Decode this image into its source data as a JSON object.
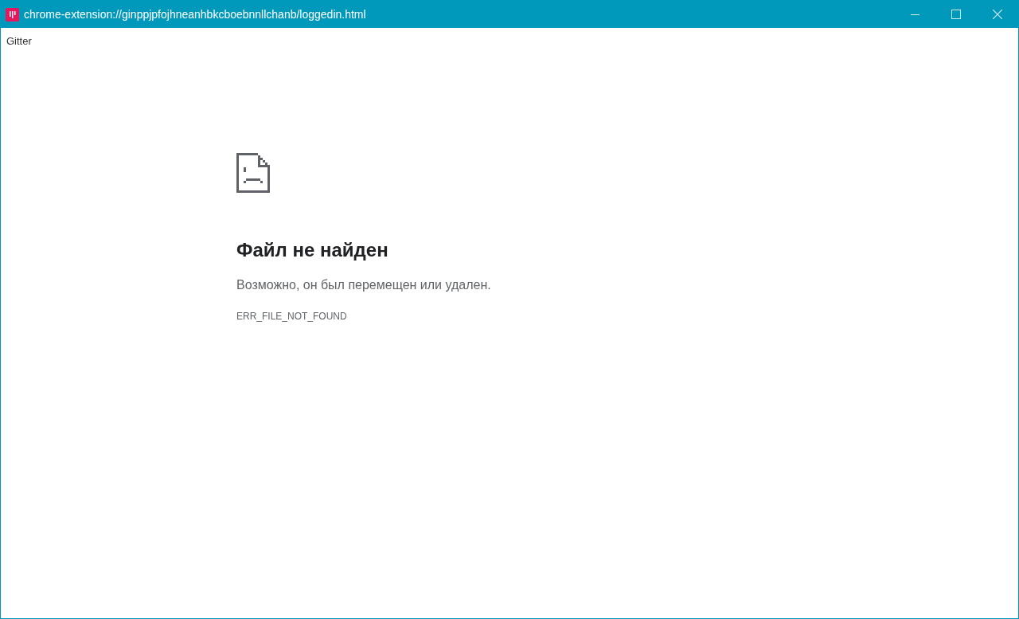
{
  "window": {
    "title": "chrome-extension://ginppjpfojhneanhbkcboebnnllchanb/loggedin.html"
  },
  "page": {
    "label": "Gitter"
  },
  "error": {
    "heading": "Файл не найден",
    "message": "Возможно, он был перемещен или удален.",
    "code": "ERR_FILE_NOT_FOUND"
  }
}
